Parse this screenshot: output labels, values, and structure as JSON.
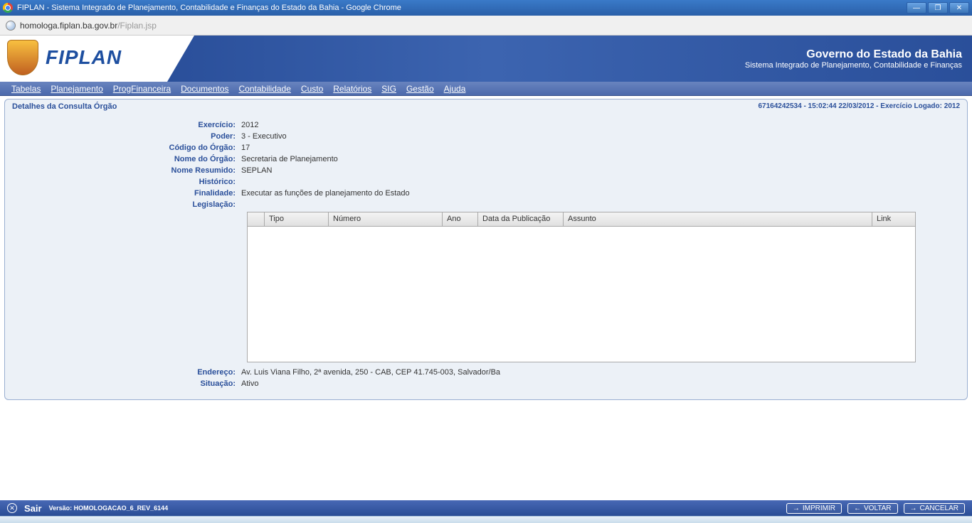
{
  "browser": {
    "title": "FIPLAN - Sistema Integrado de Planejamento, Contabilidade e Finanças do Estado da Bahia - Google Chrome",
    "url_host": "homologa.fiplan.ba.gov.br",
    "url_path": "/Fiplan.jsp"
  },
  "banner": {
    "logo_text": "FIPLAN",
    "title": "Governo do Estado da Bahia",
    "subtitle": "Sistema Integrado de Planejamento, Contabilidade e Finanças"
  },
  "menu": {
    "tabelas": "Tabelas",
    "planejamento": "Planejamento",
    "progfinanceira": "ProgFinanceira",
    "documentos": "Documentos",
    "contabilidade": "Contabilidade",
    "custo": "Custo",
    "relatorios": "Relatórios",
    "sig": "SIG",
    "gestao": "Gestão",
    "ajuda": "Ajuda"
  },
  "panel": {
    "title": "Detalhes da Consulta Órgão",
    "status": "67164242534 - 15:02:44 22/03/2012 - Exercício Logado: 2012"
  },
  "fields": {
    "exercicio_label": "Exercício:",
    "exercicio": "2012",
    "poder_label": "Poder:",
    "poder": "3 - Executivo",
    "codigo_label": "Código do Órgão:",
    "codigo": "17",
    "nome_label": "Nome do Órgão:",
    "nome": "Secretaria de Planejamento",
    "resumido_label": "Nome Resumido:",
    "resumido": "SEPLAN",
    "historico_label": "Histórico:",
    "historico": "",
    "finalidade_label": "Finalidade:",
    "finalidade": "Executar as funções de planejamento do Estado",
    "legislacao_label": "Legislação:",
    "endereco_label": "Endereço:",
    "endereco": "Av. Luis Viana Filho, 2ª avenida, 250 - CAB, CEP 41.745-003, Salvador/Ba",
    "situacao_label": "Situação:",
    "situacao": "Ativo"
  },
  "grid_headers": {
    "tipo": "Tipo",
    "numero": "Número",
    "ano": "Ano",
    "data_pub": "Data da Publicação",
    "assunto": "Assunto",
    "link": "Link"
  },
  "footer": {
    "sair": "Sair",
    "versao": "Versão: HOMOLOGACAO_6_REV_6144",
    "imprimir": "IMPRIMIR",
    "voltar": "VOLTAR",
    "cancelar": "CANCELAR"
  }
}
